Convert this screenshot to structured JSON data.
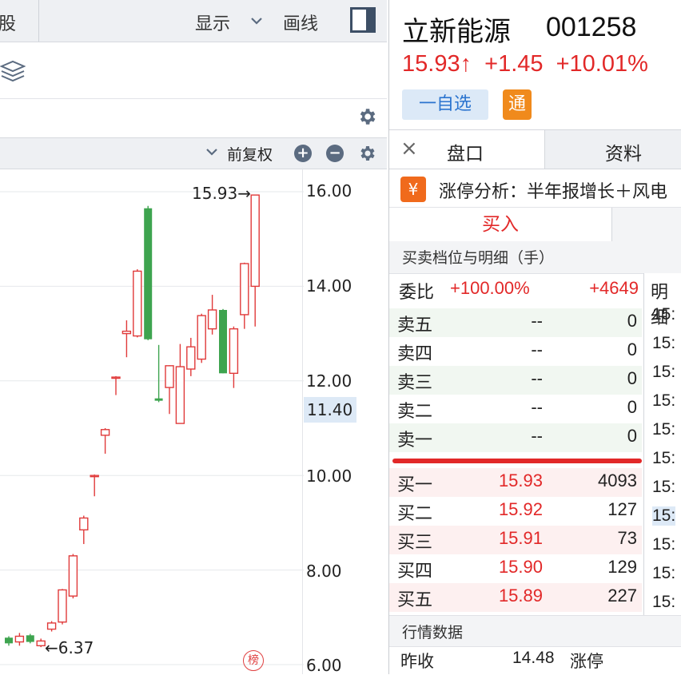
{
  "chart_toolbar": {
    "left_partial": "股",
    "display_label": "显示",
    "drawline_label": "画线"
  },
  "chart_subbar": {
    "adjust_label": "前复权"
  },
  "chart": {
    "y_ticks": [
      "16.00",
      "14.00",
      "12.00",
      "10.00",
      "8.00",
      "6.00"
    ],
    "current_price_marker": "11.40",
    "high_label": "15.93→",
    "low_label": "←6.37",
    "rank_badge": "榜",
    "colors": {
      "up": "#e03a3a",
      "down": "#3ea44f"
    }
  },
  "chart_data": {
    "type": "candlestick",
    "ylim": [
      6.0,
      16.0
    ],
    "candles": [
      {
        "o": 6.57,
        "c": 6.45,
        "h": 6.6,
        "l": 6.4
      },
      {
        "o": 6.48,
        "c": 6.6,
        "h": 6.67,
        "l": 6.4
      },
      {
        "o": 6.62,
        "c": 6.48,
        "h": 6.65,
        "l": 6.45
      },
      {
        "o": 6.4,
        "c": 6.5,
        "h": 6.55,
        "l": 6.37
      },
      {
        "o": 6.75,
        "c": 6.88,
        "h": 6.92,
        "l": 6.7
      },
      {
        "o": 6.9,
        "c": 7.58,
        "h": 7.6,
        "l": 6.85
      },
      {
        "o": 7.45,
        "c": 8.3,
        "h": 8.34,
        "l": 7.4
      },
      {
        "o": 8.85,
        "c": 9.1,
        "h": 9.15,
        "l": 8.55
      },
      {
        "o": 9.98,
        "c": 10.0,
        "h": 10.02,
        "l": 9.56
      },
      {
        "o": 10.85,
        "c": 10.97,
        "h": 11.0,
        "l": 10.46
      },
      {
        "o": 12.08,
        "c": 12.08,
        "h": 12.1,
        "l": 11.7
      },
      {
        "o": 13.0,
        "c": 13.05,
        "h": 13.28,
        "l": 12.5
      },
      {
        "o": 12.95,
        "c": 14.32,
        "h": 14.36,
        "l": 12.92
      },
      {
        "o": 15.65,
        "c": 12.88,
        "h": 15.7,
        "l": 12.86
      },
      {
        "o": 11.63,
        "c": 11.58,
        "h": 12.76,
        "l": 11.55
      },
      {
        "o": 11.86,
        "c": 12.32,
        "h": 12.33,
        "l": 11.3
      },
      {
        "o": 11.1,
        "c": 12.3,
        "h": 12.78,
        "l": 11.1
      },
      {
        "o": 12.25,
        "c": 12.72,
        "h": 12.91,
        "l": 12.1
      },
      {
        "o": 12.46,
        "c": 13.38,
        "h": 13.42,
        "l": 12.38
      },
      {
        "o": 13.1,
        "c": 13.5,
        "h": 13.82,
        "l": 12.98
      },
      {
        "o": 13.5,
        "c": 12.16,
        "h": 13.52,
        "l": 12.16
      },
      {
        "o": 12.16,
        "c": 13.1,
        "h": 13.15,
        "l": 11.85
      },
      {
        "o": 13.4,
        "c": 14.48,
        "h": 14.5,
        "l": 13.1
      },
      {
        "o": 14.0,
        "c": 15.93,
        "h": 15.93,
        "l": 13.15
      }
    ]
  },
  "stock": {
    "name": "立新能源",
    "code": "001258",
    "price": "15.93↑",
    "change": "+1.45",
    "change_pct": "+10.01%",
    "fav_label": "一自选",
    "tong_label": "通"
  },
  "tabs": {
    "close_glyph": "×",
    "tab1": "盘口",
    "tab2": "资料"
  },
  "limit_analysis": {
    "icon": "¥",
    "text": "涨停分析：半年报增长＋风电"
  },
  "trade": {
    "buy_label": "买入",
    "section_title": "买卖档位与明细（手）",
    "ratio_label": "委比",
    "ratio_pct": "+100.00%",
    "ratio_diff": "+4649",
    "detail_head": "明细"
  },
  "order_book": {
    "sell": [
      {
        "label": "卖五",
        "price": "--",
        "vol": "0"
      },
      {
        "label": "卖四",
        "price": "--",
        "vol": "0"
      },
      {
        "label": "卖三",
        "price": "--",
        "vol": "0"
      },
      {
        "label": "卖二",
        "price": "--",
        "vol": "0"
      },
      {
        "label": "卖一",
        "price": "--",
        "vol": "0"
      }
    ],
    "buy": [
      {
        "label": "买一",
        "price": "15.93",
        "vol": "4093"
      },
      {
        "label": "买二",
        "price": "15.92",
        "vol": "127"
      },
      {
        "label": "买三",
        "price": "15.91",
        "vol": "73"
      },
      {
        "label": "买四",
        "price": "15.90",
        "vol": "129"
      },
      {
        "label": "买五",
        "price": "15.89",
        "vol": "227"
      }
    ]
  },
  "detail_times": [
    "15:",
    "15:",
    "15:",
    "15:",
    "15:",
    "15:",
    "15:",
    "15:",
    "15:",
    "15:",
    "15:",
    "15:"
  ],
  "market": {
    "title": "行情数据",
    "prev_close_label": "昨收",
    "prev_close_value": "14.48",
    "limit_up_label": "涨停"
  }
}
